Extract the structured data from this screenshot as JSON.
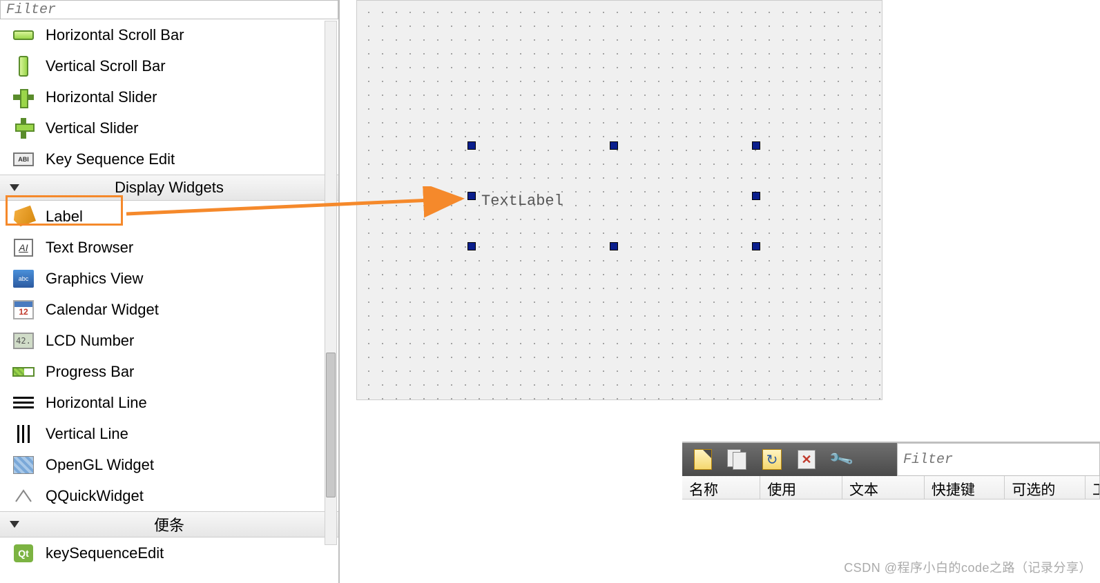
{
  "sidebar": {
    "filter_placeholder": "Filter",
    "widgets_above": [
      {
        "id": "hscroll",
        "label": "Horizontal Scroll Bar"
      },
      {
        "id": "vscroll",
        "label": "Vertical Scroll Bar"
      },
      {
        "id": "hslider",
        "label": "Horizontal Slider"
      },
      {
        "id": "vslider",
        "label": "Vertical Slider"
      },
      {
        "id": "keyseq",
        "label": "Key Sequence Edit"
      }
    ],
    "category_display": "Display Widgets",
    "display_widgets": [
      {
        "id": "label",
        "label": "Label"
      },
      {
        "id": "textbrowser",
        "label": "Text Browser"
      },
      {
        "id": "graphicsview",
        "label": "Graphics View"
      },
      {
        "id": "calendar",
        "label": "Calendar Widget"
      },
      {
        "id": "lcd",
        "label": "LCD Number"
      },
      {
        "id": "progress",
        "label": "Progress Bar"
      },
      {
        "id": "hline",
        "label": "Horizontal Line"
      },
      {
        "id": "vline",
        "label": "Vertical Line"
      },
      {
        "id": "opengl",
        "label": "OpenGL Widget"
      },
      {
        "id": "qquick",
        "label": "QQuickWidget"
      }
    ],
    "category_scratch": "便条",
    "scratch_widgets": [
      {
        "id": "keyseqedit",
        "label": "keySequenceEdit"
      }
    ]
  },
  "canvas": {
    "selected_text": "TextLabel"
  },
  "bottom": {
    "filter_placeholder": "Filter",
    "columns": [
      "名称",
      "使用",
      "文本",
      "快捷键",
      "可选的",
      "工具提"
    ]
  },
  "icons": {
    "keyseq_text": "ABI",
    "textbrowser_text": "AI",
    "graphics_text": "abc",
    "lcd_text": "42.",
    "qt_text": "Qt"
  },
  "watermark": "CSDN @程序小白的code之路（记录分享）"
}
